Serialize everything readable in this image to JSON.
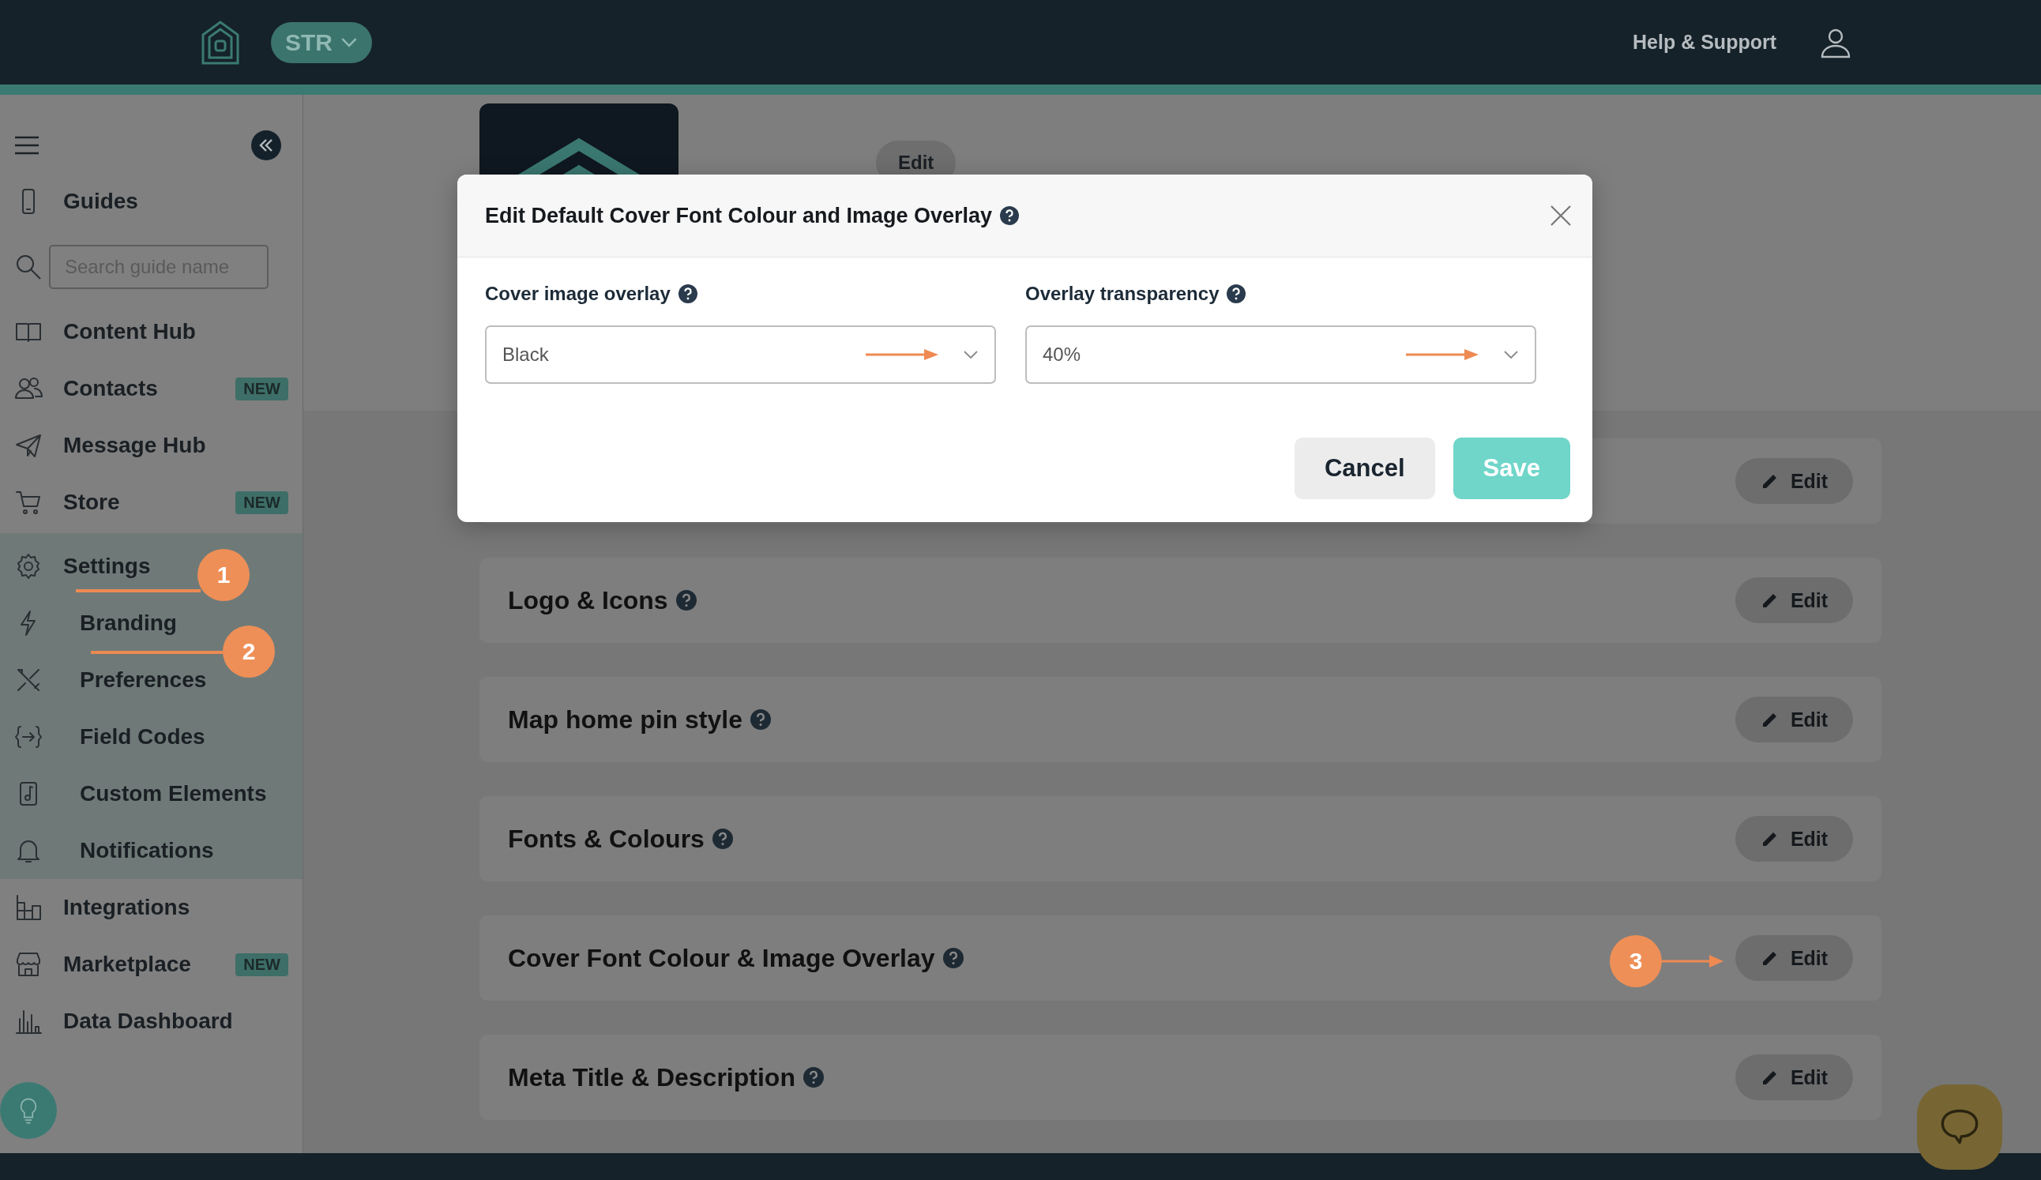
{
  "topbar": {
    "workspace": "STR",
    "help_link": "Help & Support"
  },
  "sidebar": {
    "items": [
      {
        "kind": "link",
        "label": "Guides"
      },
      {
        "kind": "search",
        "placeholder": "Search guide name"
      },
      {
        "kind": "link",
        "label": "Content Hub"
      },
      {
        "kind": "link",
        "label": "Contacts",
        "badge": "NEW"
      },
      {
        "kind": "link",
        "label": "Message Hub"
      },
      {
        "kind": "link",
        "label": "Store",
        "badge": "NEW"
      },
      {
        "kind": "group",
        "label": "Settings",
        "expanded": true,
        "children": [
          {
            "label": "Branding"
          },
          {
            "label": "Preferences"
          },
          {
            "label": "Field Codes"
          },
          {
            "label": "Custom Elements"
          },
          {
            "label": "Notifications"
          }
        ]
      },
      {
        "kind": "link",
        "label": "Integrations"
      },
      {
        "kind": "link",
        "label": "Marketplace",
        "badge": "NEW"
      },
      {
        "kind": "link",
        "label": "Data Dashboard"
      }
    ]
  },
  "guide_header": {
    "edit_button": "Edit"
  },
  "sections": [
    {
      "edit_button": "Edit"
    },
    {
      "title": "Logo & Icons",
      "edit_button": "Edit"
    },
    {
      "title": "Map home pin style",
      "edit_button": "Edit"
    },
    {
      "title": "Fonts & Colours",
      "edit_button": "Edit"
    },
    {
      "title": "Cover Font Colour & Image Overlay",
      "edit_button": "Edit"
    },
    {
      "title": "Meta Title & Description",
      "edit_button": "Edit"
    }
  ],
  "modal": {
    "title": "Edit Default Cover Font Colour and Image Overlay",
    "fields": [
      {
        "label": "Cover image overlay",
        "value": "Black"
      },
      {
        "label": "Overlay transparency",
        "value": "40%"
      }
    ],
    "buttons": [
      {
        "label": "Cancel",
        "kind": "secondary"
      },
      {
        "label": "Save",
        "kind": "primary"
      }
    ]
  },
  "annotations": [
    {
      "label": "1"
    },
    {
      "label": "2"
    },
    {
      "label": "3"
    }
  ]
}
